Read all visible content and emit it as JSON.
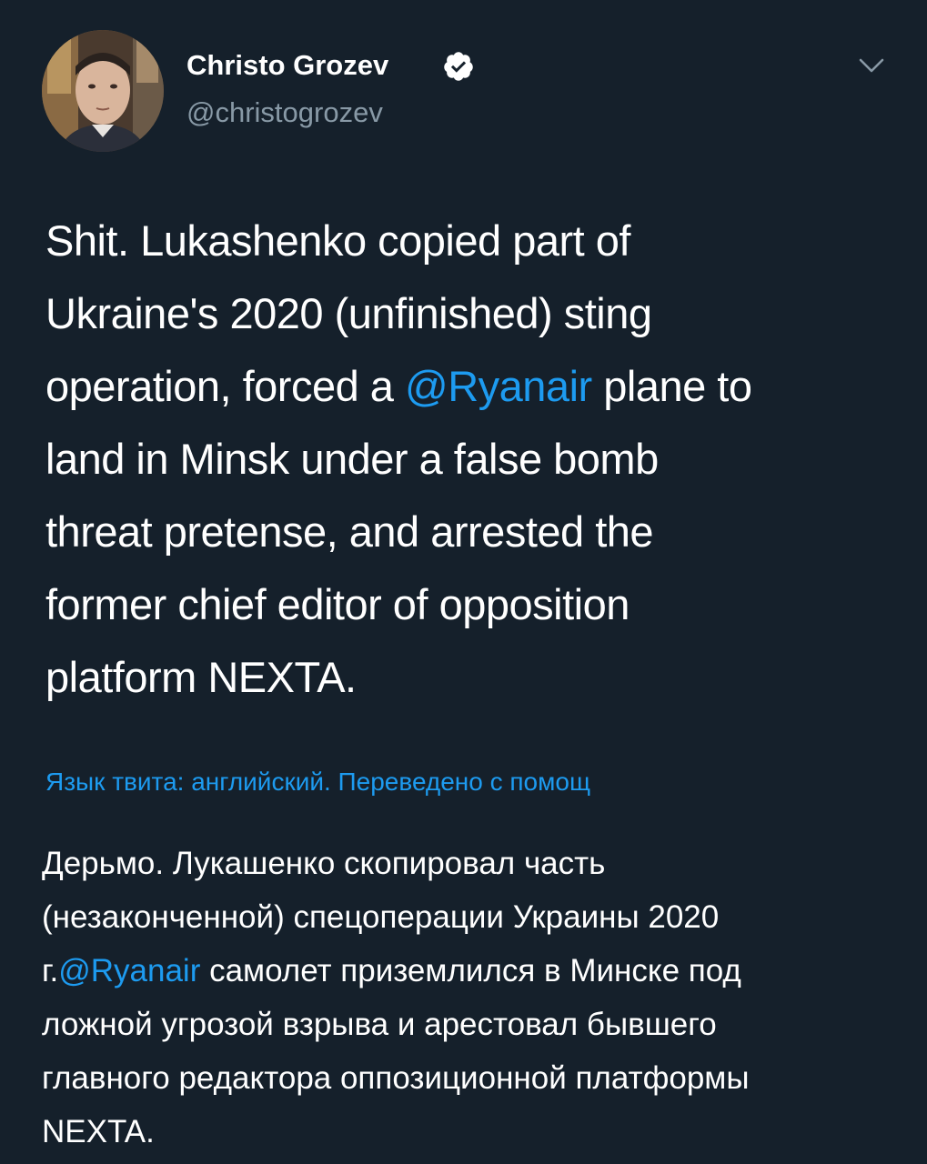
{
  "author": {
    "name": "Christo Grozev",
    "handle": "@christogrozev",
    "verified": true
  },
  "icons": {
    "verified": "verified-badge-icon",
    "more": "chevron-down-icon"
  },
  "tweet": {
    "lines": [
      "Shit. Lukashenko copied part of",
      "Ukraine's 2020 (unfinished) sting",
      {
        "before": "operation, forced a ",
        "mention": "@Ryanair",
        "after": " plane to"
      },
      "land in Minsk under a false bomb",
      "threat pretense, and arrested the",
      "former chief editor of opposition",
      "platform NEXTA."
    ]
  },
  "translation": {
    "label": "Язык твита: английский. Переведено с помощ",
    "lines": [
      "Дерьмо. Лукашенко скопировал часть",
      "(незаконченной) спецоперации Украины 2020",
      {
        "before": "г.",
        "mention": "@Ryanair",
        "after": " самолет приземлился в Минске под"
      },
      "ложной угрозой взрыва и арестовал бывшего",
      "главного редактора оппозиционной платформы",
      "NEXTA."
    ]
  },
  "colors": {
    "background": "#15202b",
    "text": "#ffffff",
    "secondary": "#8899a6",
    "accent": "#1d9bf0"
  }
}
